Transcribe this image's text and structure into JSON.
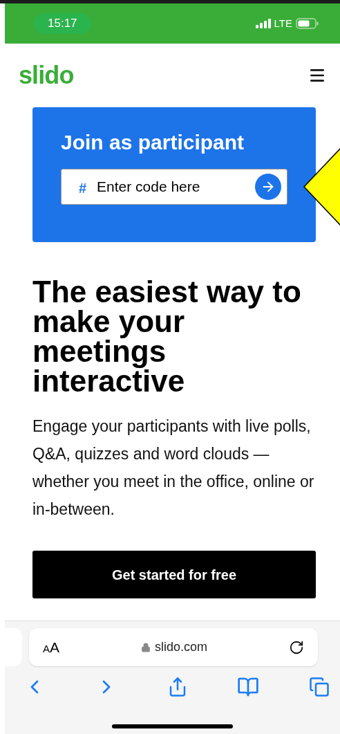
{
  "status_bar": {
    "time": "15:17",
    "network": "LTE"
  },
  "header": {
    "logo": "slido"
  },
  "join_card": {
    "title": "Join as participant",
    "prefix": "#",
    "placeholder": "Enter code here"
  },
  "hero": {
    "heading": "The easiest way to make your meetings interactive",
    "body": "Engage your participants with live polls, Q&A, quizzes and word clouds — whether you meet in the office, online or in-between.",
    "cta": "Get started for free"
  },
  "browser": {
    "text_size": "AA",
    "url": "slido.com"
  }
}
